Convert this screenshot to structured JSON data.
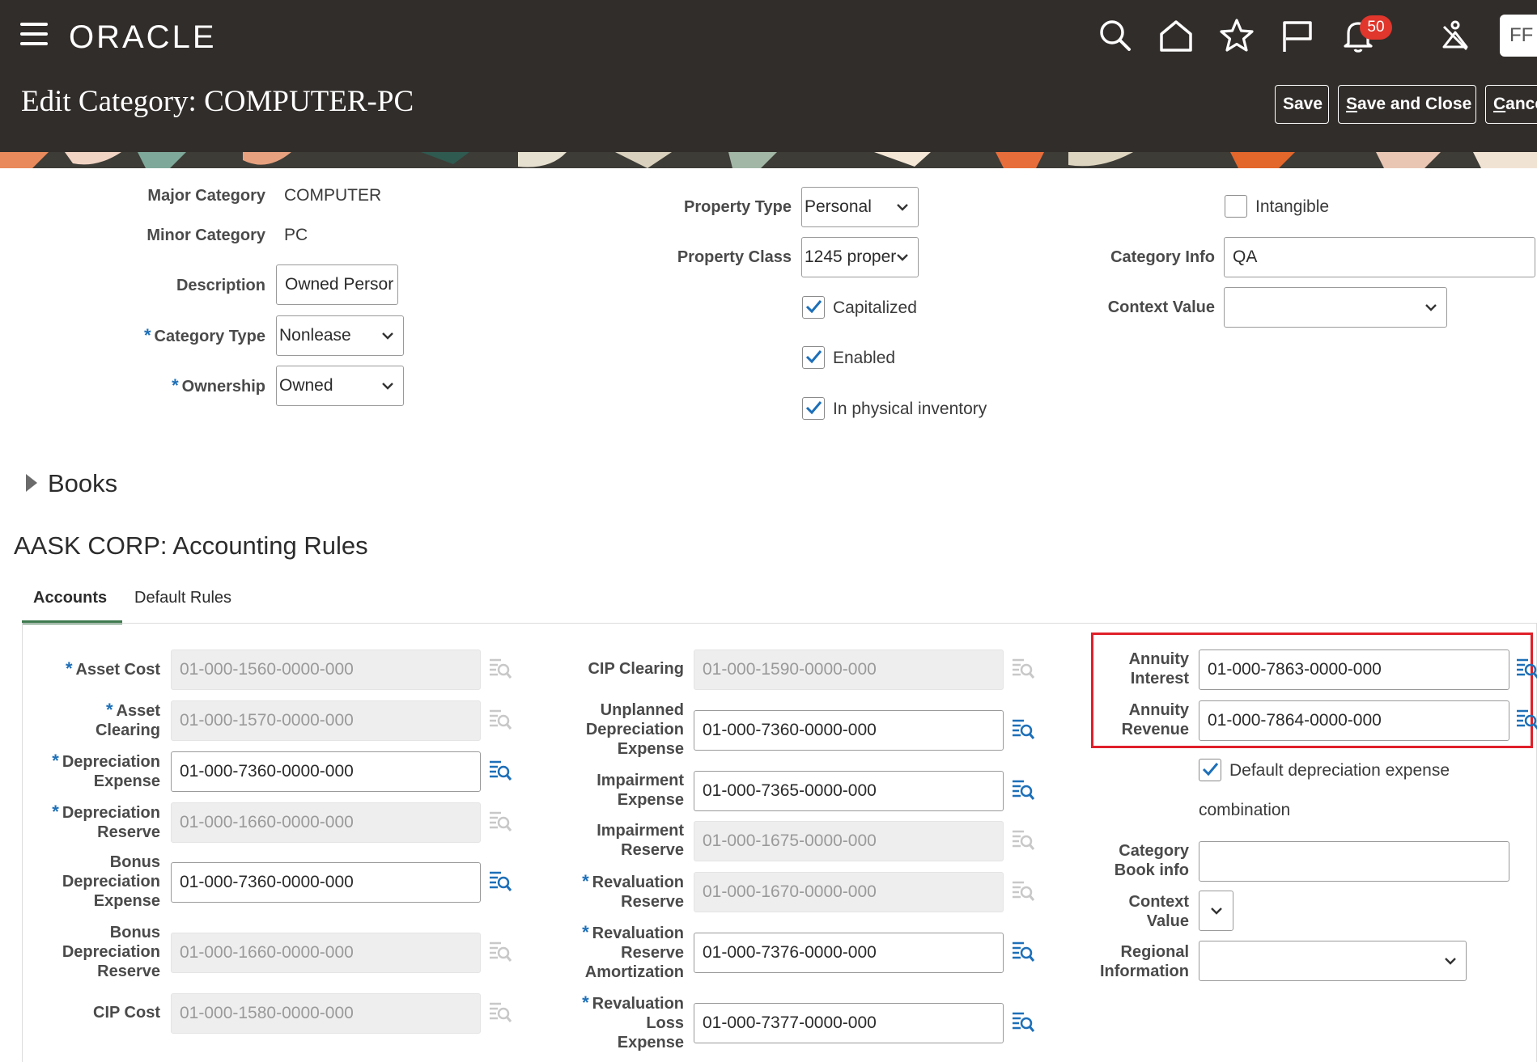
{
  "header": {
    "logo": "ORACLE",
    "notification_count": "50",
    "avatar_initials": "FF",
    "page_title": "Edit Category: COMPUTER-PC",
    "buttons": {
      "save": "Save",
      "save_close": "ave and Close",
      "save_close_mnemonic": "S",
      "cancel": "ance",
      "cancel_mnemonic": "C"
    },
    "icons": [
      "menu-icon",
      "search-icon",
      "home-icon",
      "star-icon",
      "flag-icon",
      "bell-icon",
      "accessibility-icon"
    ]
  },
  "category": {
    "major_category_label": "Major Category",
    "major_category_value": "COMPUTER",
    "minor_category_label": "Minor Category",
    "minor_category_value": "PC",
    "description_label": "Description",
    "description_value": "Owned Persor",
    "category_type_label": "Category Type",
    "category_type_value": "Nonlease",
    "ownership_label": "Ownership",
    "ownership_value": "Owned",
    "property_type_label": "Property Type",
    "property_type_value": "Personal",
    "property_class_label": "Property Class",
    "property_class_value": "1245 proper",
    "capitalized_label": "Capitalized",
    "enabled_label": "Enabled",
    "physical_inventory_label": "In physical inventory",
    "intangible_label": "Intangible",
    "category_info_label": "Category Info",
    "category_info_value": "QA",
    "context_value_label": "Context Value",
    "context_value_value": ""
  },
  "books": {
    "label": "Books"
  },
  "rules": {
    "title": "AASK CORP: Accounting Rules",
    "tabs": {
      "accounts": "Accounts",
      "default_rules": "Default Rules"
    },
    "col1": {
      "asset_cost_label": "Asset Cost",
      "asset_cost": "01-000-1560-0000-000",
      "asset_clearing_label_1": "Asset",
      "asset_clearing_label_2": "Clearing",
      "asset_clearing": "01-000-1570-0000-000",
      "dep_expense_label_1": "Depreciation",
      "dep_expense_label_2": "Expense",
      "dep_expense": "01-000-7360-0000-000",
      "dep_reserve_label_1": "Depreciation",
      "dep_reserve_label_2": "Reserve",
      "dep_reserve": "01-000-1660-0000-000",
      "bonus_dep_expense_label_1": "Bonus",
      "bonus_dep_expense_label_2": "Depreciation",
      "bonus_dep_expense_label_3": "Expense",
      "bonus_dep_expense": "01-000-7360-0000-000",
      "bonus_dep_reserve_label_1": "Bonus",
      "bonus_dep_reserve_label_2": "Depreciation",
      "bonus_dep_reserve_label_3": "Reserve",
      "bonus_dep_reserve": "01-000-1660-0000-000",
      "cip_cost_label": "CIP Cost",
      "cip_cost": "01-000-1580-0000-000"
    },
    "col2": {
      "cip_clearing_label": "CIP Clearing",
      "cip_clearing": "01-000-1590-0000-000",
      "unplanned_label_1": "Unplanned",
      "unplanned_label_2": "Depreciation",
      "unplanned_label_3": "Expense",
      "unplanned": "01-000-7360-0000-000",
      "impair_expense_label_1": "Impairment",
      "impair_expense_label_2": "Expense",
      "impair_expense": "01-000-7365-0000-000",
      "impair_reserve_label_1": "Impairment",
      "impair_reserve_label_2": "Reserve",
      "impair_reserve": "01-000-1675-0000-000",
      "reval_reserve_label_1": "Revaluation",
      "reval_reserve_label_2": "Reserve",
      "reval_reserve": "01-000-1670-0000-000",
      "reval_amort_label_1": "Revaluation",
      "reval_amort_label_2": "Reserve",
      "reval_amort_label_3": "Amortization",
      "reval_amort": "01-000-7376-0000-000",
      "reval_loss_label_1": "Revaluation",
      "reval_loss_label_2": "Loss",
      "reval_loss_label_3": "Expense",
      "reval_loss": "01-000-7377-0000-000"
    },
    "col3": {
      "annuity_interest_label_1": "Annuity",
      "annuity_interest_label_2": "Interest",
      "annuity_interest": "01-000-7863-0000-000",
      "annuity_revenue_label_1": "Annuity",
      "annuity_revenue_label_2": "Revenue",
      "annuity_revenue": "01-000-7864-0000-000",
      "default_dep_label_1": "Default depreciation expense",
      "default_dep_label_2": "combination",
      "cat_book_info_label_1": "Category",
      "cat_book_info_label_2": "Book info",
      "cat_book_info": "",
      "context_label_1": "Context",
      "context_label_2": "Value",
      "regional_label_1": "Regional",
      "regional_label_2": "Information"
    }
  },
  "colors": {
    "header_bg": "#312d2a",
    "accent_blue": "#1d6fb8",
    "highlight_red": "#e0202a",
    "checkbox_blue": "#1d6fb8"
  }
}
